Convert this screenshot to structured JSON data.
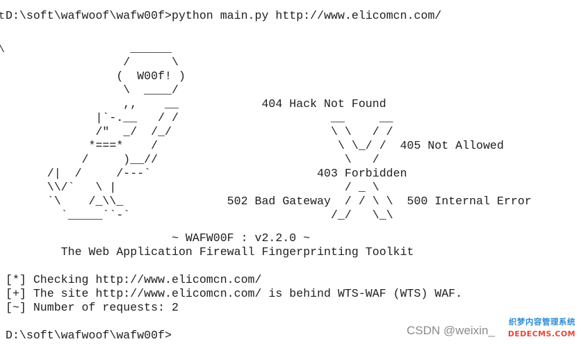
{
  "terminal": {
    "edge_glyphs": [
      "t",
      "\\"
    ],
    "command_line": {
      "prompt": "D:\\soft\\wafwoof\\wafw00f>",
      "command": "python main.py http://www.elicomcn.com/"
    },
    "banner_art": "                  ______\n                 /      \\\n                (  W00f! )\n                 \\  ____/\n                 ,,    __            404 Hack Not Found\n             |`-.__   / /                      __     __\n             /\"  _/  /_/                       \\ \\   / /\n            *===*    /                          \\ \\_/ /  405 Not Allowed\n           /     )__//                           \\   /\n      /|  /     /---`                        403 Forbidden\n      \\\\/`   \\ |                                 / _ \\\n      `\\    /_\\\\_               502 Bad Gateway  / / \\ \\  500 Internal Error\n        `_____``-`                             /_/   \\_\\",
    "version_line": "                        ~ WAFW00F : v2.2.0 ~",
    "toolkit_line": "        The Web Application Firewall Fingerprinting Toolkit",
    "output": [
      "[*] Checking http://www.elicomcn.com/",
      "[+] The site http://www.elicomcn.com/ is behind WTS-WAF (WTS) WAF.",
      "[~] Number of requests: 2"
    ],
    "final_prompt": "D:\\soft\\wafwoof\\wafw00f>"
  },
  "watermark": {
    "text": "CSDN @weixin_",
    "logo_top": "织梦内容管理系统",
    "logo_bottom": "DEDECMS.COM"
  },
  "colors": {
    "background": "#ffffff",
    "text": "#1e1e1e",
    "watermark": "#8a8a8a",
    "logo_blue": "#2f8fd6",
    "logo_red": "#e0483b"
  }
}
